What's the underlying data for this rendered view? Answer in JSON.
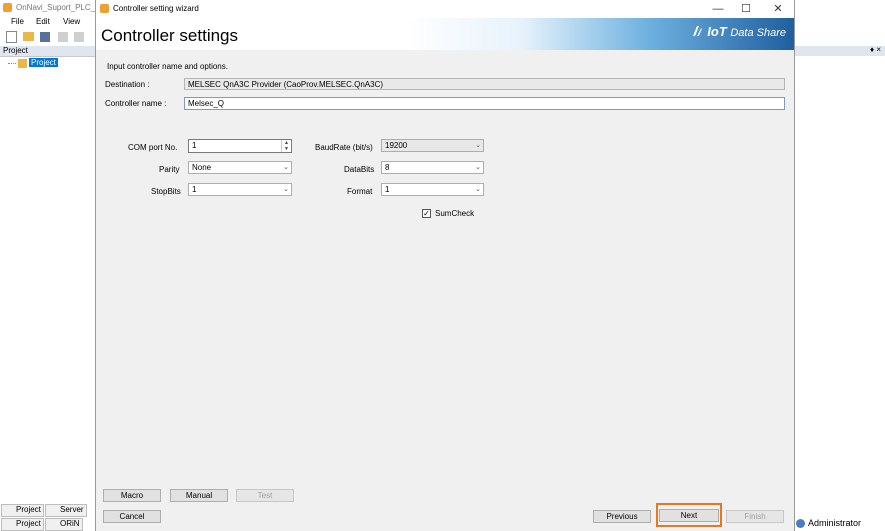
{
  "background_app": {
    "title": "OnNavi_Suport_PLC_N",
    "menu": [
      "File",
      "Edit",
      "View"
    ],
    "project_panel_title": "Project",
    "tree_root": "Project",
    "tabs_row1": [
      "Project",
      "Server"
    ],
    "tabs_row2": [
      "Project",
      "ORiN"
    ],
    "user": "Administrator",
    "right_panel_pin": "♦ ×"
  },
  "dialog": {
    "window_title": "Controller setting wizard",
    "heading": "Controller settings",
    "brand": "IoT",
    "brand_sub": "Data Share",
    "instruction": "Input controller name and options.",
    "destination_label": "Destination :",
    "destination_value": "MELSEC QnA3C Provider (CaoProv.MELSEC.QnA3C)",
    "controller_name_label": "Controller name :",
    "controller_name_value": "Melsec_Q",
    "com_port_label": "COM port No.",
    "com_port_value": "1",
    "parity_label": "Parity",
    "parity_value": "None",
    "stopbits_label": "StopBits",
    "stopbits_value": "1",
    "baudrate_label": "BaudRate (bit/s)",
    "baudrate_value": "19200",
    "databits_label": "DataBits",
    "databits_value": "8",
    "format_label": "Format",
    "format_value": "1",
    "sumcheck_label": "SumCheck",
    "sumcheck_checked": true,
    "buttons": {
      "macro": "Macro",
      "manual": "Manual",
      "test": "Test",
      "cancel": "Cancel",
      "previous": "Previous",
      "next": "Next",
      "finish": "Finish"
    }
  },
  "colors": {
    "highlight": "#e87722",
    "selection": "#0078d7",
    "brand_dark": "#1f5f9f"
  }
}
